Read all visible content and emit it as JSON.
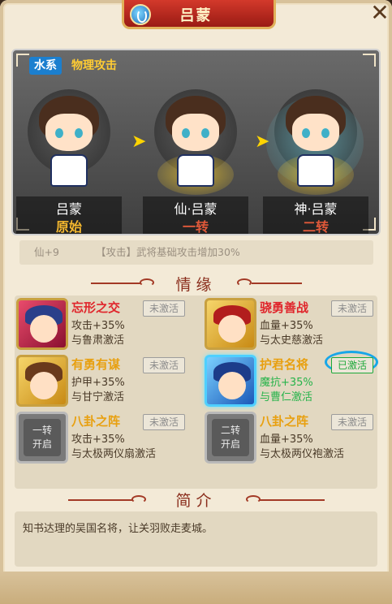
{
  "header": {
    "title": "吕蒙",
    "close_label": "✕"
  },
  "hero": {
    "element_tag": "水系",
    "attack_tag": "物理攻击",
    "stages": [
      {
        "name": "吕蒙",
        "rank": "原始",
        "rank_color": "#f5b82e"
      },
      {
        "name": "仙·吕蒙",
        "rank": "一转",
        "rank_color": "#e0593a"
      },
      {
        "name": "神·吕蒙",
        "rank": "二转",
        "rank_color": "#e0593a"
      }
    ]
  },
  "skill": {
    "level": "仙+9",
    "desc": "【攻击】武将基础攻击增加30%"
  },
  "fate": {
    "title": "情缘",
    "cards": [
      {
        "name": "忘形之交",
        "name_color": "#e0252b",
        "status": "未激活",
        "effect": "攻击+35%",
        "condition": "与鲁肃激活"
      },
      {
        "name": "骁勇善战",
        "name_color": "#e0252b",
        "status": "未激活",
        "effect": "血量+35%",
        "condition": "与太史慈激活"
      },
      {
        "name": "有勇有谋",
        "name_color": "#e8a010",
        "status": "未激活",
        "effect": "护甲+35%",
        "condition": "与甘宁激活"
      },
      {
        "name": "护君名将",
        "name_color": "#e8a010",
        "status": "已激活",
        "effect": "魔抗+35%",
        "condition": "与曹仁激活"
      },
      {
        "name": "八卦之阵",
        "name_color": "#e8a010",
        "status": "未激活",
        "effect": "攻击+35%",
        "condition": "与太极两仪扇激活",
        "lock_line1": "一转",
        "lock_line2": "开启"
      },
      {
        "name": "八卦之阵",
        "name_color": "#e8a010",
        "status": "未激活",
        "effect": "血量+35%",
        "condition": "与太极两仪袍激活",
        "lock_line1": "二转",
        "lock_line2": "开启"
      }
    ]
  },
  "intro": {
    "title": "简介",
    "text": "知书达理的吴国名将，让关羽败走麦城。"
  },
  "colors": {
    "accent_red": "#a33a26",
    "active_green": "#26b34a",
    "highlight_blue": "#18a6e8"
  }
}
